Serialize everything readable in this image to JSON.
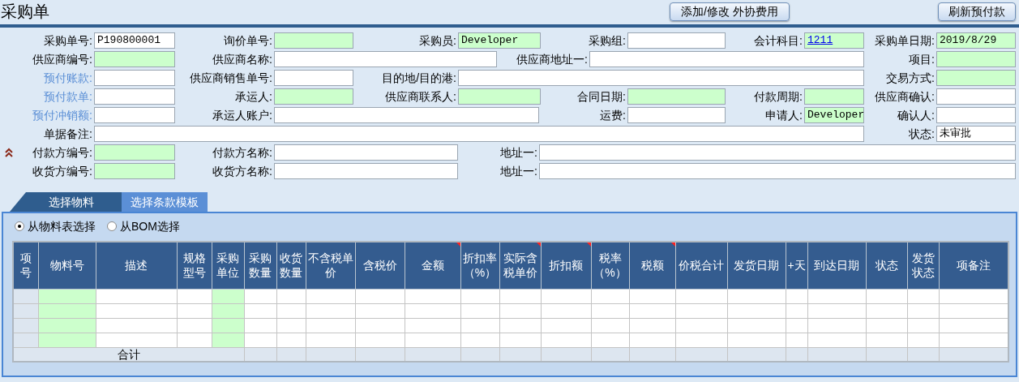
{
  "title": "采购单",
  "buttons": [
    "添加/修改 外协费用",
    "刷新预付款"
  ],
  "form": {
    "fields": [
      {
        "label": "采购单号:",
        "value": "P190800001",
        "required": false,
        "link": false
      },
      {
        "label": "询价单号:",
        "required": true,
        "link": false
      },
      {
        "label": "采购员:",
        "value": "Developer",
        "required": true,
        "link": false
      },
      {
        "label": "采购组:",
        "required": false,
        "link": false
      },
      {
        "label": "会计科目:",
        "value": "1211",
        "value_link": true,
        "required": true,
        "link": false
      },
      {
        "label": "采购单日期:",
        "value": "2019/8/29",
        "required": true,
        "link": false
      },
      {
        "label": "供应商编号:",
        "required": true,
        "link": false
      },
      {
        "label": "供应商名称:",
        "required": false,
        "link": false
      },
      {
        "label": "供应商地址一:",
        "required": false,
        "link": false
      },
      {
        "label": "项目:",
        "required": true,
        "link": false
      },
      {
        "label": "预付账款:",
        "required": false,
        "link": true
      },
      {
        "label": "供应商销售单号:",
        "required": false,
        "link": false
      },
      {
        "label": "目的地/目的港:",
        "required": false,
        "link": false
      },
      {
        "label": "交易方式:",
        "required": true,
        "link": false
      },
      {
        "label": "预付款单:",
        "required": false,
        "link": true
      },
      {
        "label": "承运人:",
        "required": true,
        "link": false
      },
      {
        "label": "供应商联系人:",
        "required": true,
        "link": false
      },
      {
        "label": "合同日期:",
        "required": true,
        "link": false
      },
      {
        "label": "付款周期:",
        "required": true,
        "link": false
      },
      {
        "label": "供应商确认:",
        "required": false,
        "link": false
      },
      {
        "label": "预付冲销额:",
        "required": false,
        "link": true
      },
      {
        "label": "承运人账户:",
        "required": false,
        "link": false
      },
      {
        "label": "运费:",
        "required": false,
        "link": false
      },
      {
        "label": "申请人:",
        "value": "Developer",
        "required": true,
        "link": false
      },
      {
        "label": "确认人:",
        "required": false,
        "link": false
      },
      {
        "label": "单据备注:",
        "required": false,
        "link": false
      },
      {
        "label": "状态:",
        "value": "未审批",
        "required": false,
        "link": false
      },
      {
        "label": "付款方编号:",
        "required": true,
        "link": false
      },
      {
        "label": "付款方名称:",
        "required": false,
        "link": false
      },
      {
        "label": "地址一:",
        "required": false,
        "link": false
      },
      {
        "label": "收货方编号:",
        "required": true,
        "link": false
      },
      {
        "label": "收货方名称:",
        "required": false,
        "link": false
      },
      {
        "label": "地址一:",
        "required": false,
        "link": false
      }
    ],
    "expanded": true
  },
  "tabs": [
    {
      "label": "选择物料",
      "selected": true
    },
    {
      "label": "选择条款模板",
      "selected": false
    }
  ],
  "radios": [
    {
      "label": "从物料表选择",
      "selected": true
    },
    {
      "label": "从BOM选择",
      "selected": false
    }
  ],
  "table": {
    "columns": [
      {
        "label": "项号",
        "kind": "index",
        "marked": false
      },
      {
        "label": "物料号",
        "kind": "required",
        "marked": false
      },
      {
        "label": "描述",
        "kind": "plain",
        "marked": false
      },
      {
        "label": "规格型号",
        "kind": "plain",
        "marked": false
      },
      {
        "label": "采购单位",
        "kind": "required",
        "marked": false
      },
      {
        "label": "采购数量",
        "kind": "plain",
        "marked": false
      },
      {
        "label": "收货数量",
        "kind": "plain",
        "marked": false
      },
      {
        "label": "不含税单价",
        "kind": "plain",
        "marked": false
      },
      {
        "label": "含税价",
        "kind": "plain",
        "marked": false
      },
      {
        "label": "金额",
        "kind": "plain",
        "marked": true
      },
      {
        "label": "折扣率（%）",
        "kind": "plain",
        "marked": false
      },
      {
        "label": "实际含税单价",
        "kind": "plain",
        "marked": true
      },
      {
        "label": "折扣额",
        "kind": "plain",
        "marked": true
      },
      {
        "label": "税率（%）",
        "kind": "plain",
        "marked": false
      },
      {
        "label": "税额",
        "kind": "plain",
        "marked": true
      },
      {
        "label": "价税合计",
        "kind": "plain",
        "marked": false
      },
      {
        "label": "发货日期",
        "kind": "plain",
        "marked": false
      },
      {
        "label": "+天",
        "kind": "plain",
        "marked": false
      },
      {
        "label": "到达日期",
        "kind": "plain",
        "marked": false
      },
      {
        "label": "状态",
        "kind": "plain",
        "marked": false
      },
      {
        "label": "发货状态",
        "kind": "plain",
        "marked": false
      },
      {
        "label": "项备注",
        "kind": "plain",
        "marked": false
      }
    ],
    "total_label": "合计"
  }
}
